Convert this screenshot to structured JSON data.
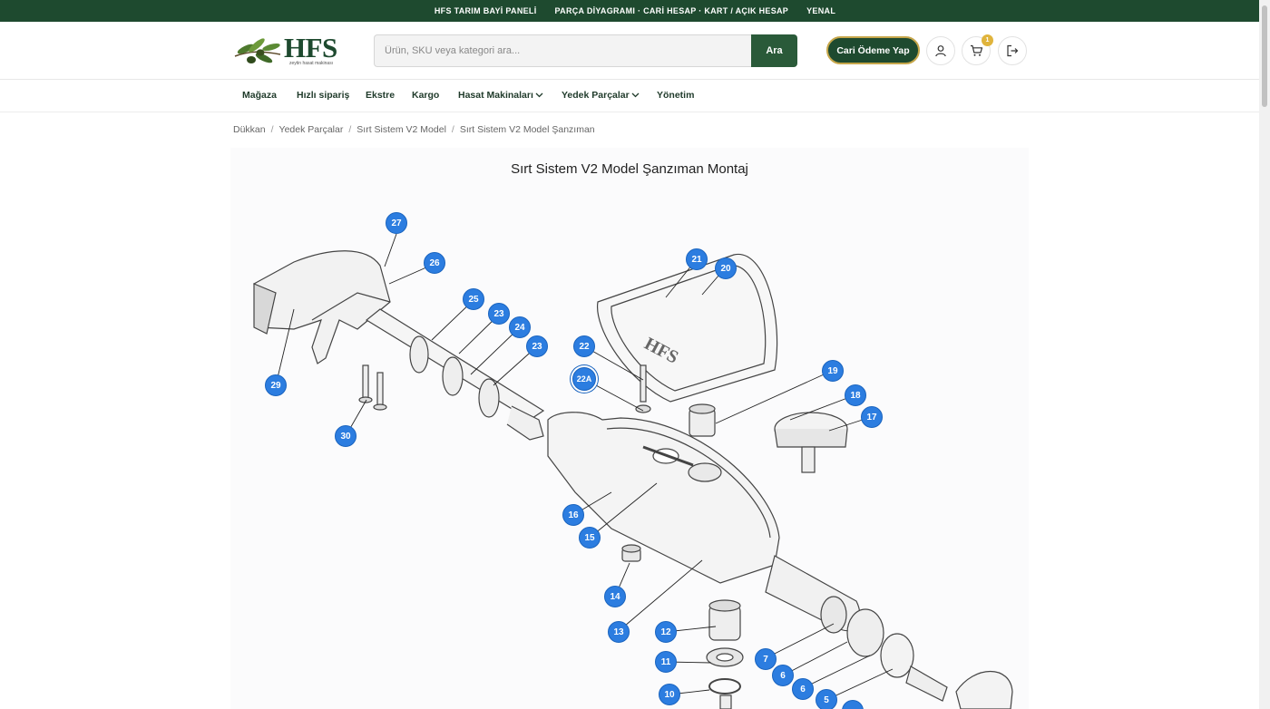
{
  "topbar": {
    "items": [
      "HFS TARIM BAYİ PANELİ",
      "PARÇA DİYAGRAMI · CARİ HESAP · KART / AÇIK HESAP",
      "YENAL"
    ]
  },
  "logo": {
    "text": "HFS",
    "tagline": "zeytin hasat makinası"
  },
  "search": {
    "placeholder": "Ürün, SKU veya kategori ara...",
    "button": "Ara"
  },
  "header": {
    "pay_button": "Cari Ödeme Yap",
    "cart_count": "1"
  },
  "nav": {
    "items": [
      "Mağaza",
      "Hızlı sipariş",
      "Ekstre",
      "Kargo",
      "Hasat Makinaları",
      "Yedek Parçalar",
      "Yönetim"
    ]
  },
  "breadcrumb": [
    "Dükkan",
    "Yedek Parçalar",
    "Sırt Sistem V2 Model",
    "Sırt Sistem V2 Model Şanzıman"
  ],
  "diagram": {
    "title": "Sırt Sistem V2 Model Şanzıman Montaj",
    "callouts": [
      "27",
      "26",
      "25",
      "23",
      "24",
      "23",
      "29",
      "30",
      "21",
      "20",
      "22",
      "22A",
      "19",
      "18",
      "17",
      "16",
      "15",
      "14",
      "13",
      "12",
      "11",
      "10",
      "7",
      "6",
      "6",
      "5"
    ]
  },
  "colors": {
    "topbar": "#1e4a2f",
    "accent": "#2a5a39",
    "callout": "#2c7de0",
    "badge": "#e0b43c"
  }
}
